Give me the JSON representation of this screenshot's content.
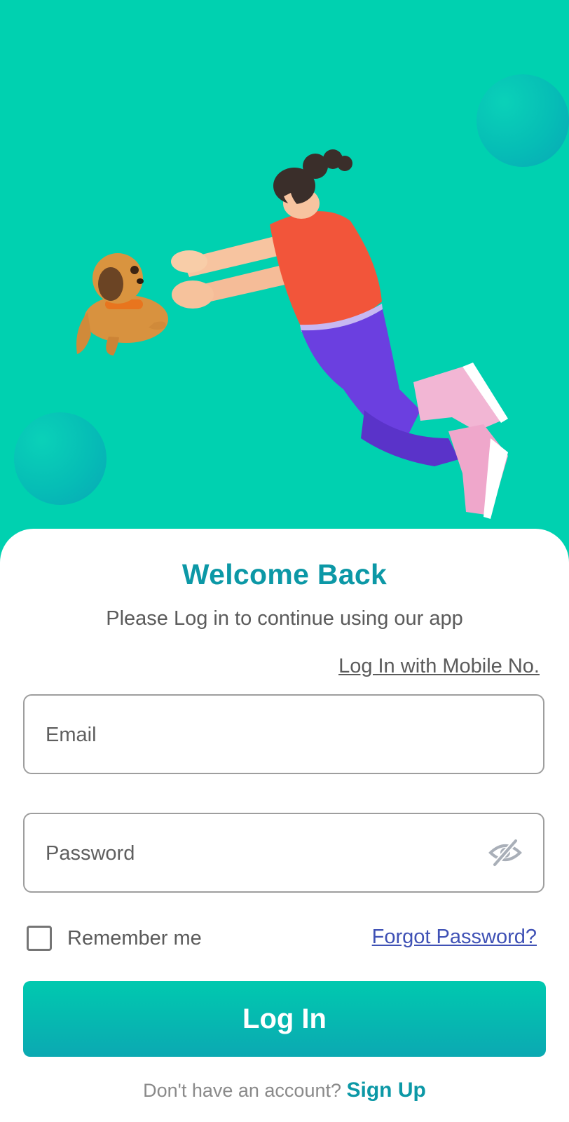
{
  "colors": {
    "hero_background": "#00D1B0",
    "accent": "#0C98A6",
    "link": "#3F51B5",
    "button_gradient": [
      "#00C9AF",
      "#0BA9B2"
    ]
  },
  "hero": {
    "illustration": "woman-leaping-to-catch-puppy"
  },
  "welcome": {
    "title": "Welcome Back",
    "subtitle": "Please Log in to continue using our app"
  },
  "login_form": {
    "mobile_link": "Log In with Mobile No.",
    "email": {
      "placeholder": "Email",
      "value": ""
    },
    "password": {
      "placeholder": "Password",
      "value": "",
      "toggle_icon": "eye-off-icon"
    },
    "remember_me": {
      "label": "Remember me",
      "checked": false
    },
    "forgot_password": "Forgot Password?",
    "submit_label": "Log In"
  },
  "footer": {
    "prompt": "Don't have an account?",
    "signup_label": "Sign Up"
  }
}
